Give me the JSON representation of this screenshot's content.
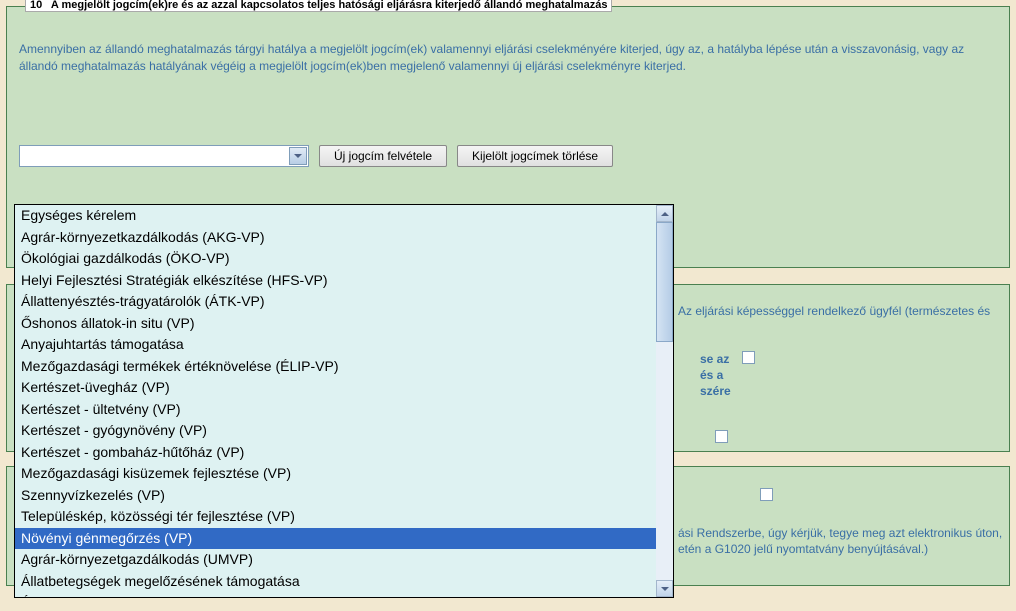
{
  "section10": {
    "number": "10",
    "title": "A megjelölt jogcím(ek)re és az azzal kapcsolatos teljes hatósági eljárásra kiterjedő állandó meghatalmazás",
    "description": "Amennyiben az állandó meghatalmazás tárgyi hatálya a megjelölt jogcím(ek) valamennyi eljárási cselekményére kiterjed, úgy az, a hatályba lépése után a visszavonásig, vagy az állandó meghatalmazás hatályának végéig a megjelölt jogcím(ek)ben megjelenő valamennyi új eljárási cselekményre kiterjed.",
    "btn_new": "Új jogcím felvétele",
    "btn_delete": "Kijelölt jogcímek törlése"
  },
  "dropdown": {
    "items": [
      "Egységes kérelem",
      "Agrár-környezetkazdálkodás (AKG-VP)",
      "Ökológiai gazdálkodás (ÖKO-VP)",
      "Helyi Fejlesztési Stratégiák elkészítése (HFS-VP)",
      "Állattenyésztés-trágyatárolók (ÁTK-VP)",
      "Őshonos állatok-in situ (VP)",
      "Anyajuhtartás támogatása",
      "Mezőgazdasági termékek értéknövelése (ÉLIP-VP)",
      "Kertészet-üvegház (VP)",
      "Kertészet - ültetvény (VP)",
      "Kertészet - gyógynövény (VP)",
      "Kertészet - gombaház-hűtőház (VP)",
      "Mezőgazdasági kisüzemek fejlesztése (VP)",
      "Szennyvízkezelés (VP)",
      "Településkép, közösségi tér fejlesztése (VP)",
      "Növényi génmegőrzés (VP)",
      "Agrár-környezetgazdálkodás (UMVP)",
      "Állatbetegségek megelőzésének támogatása",
      "Állati génmegőrzés"
    ],
    "highlighted_index": 15
  },
  "partial": {
    "line1": "Az eljárási képességgel rendelkező ügyfél (természetes és",
    "line2a": "se az",
    "line2b": "és a",
    "line2c": "szére",
    "line3": "ási Rendszerbe, úgy kérjük, tegye meg azt elektronikus úton,",
    "line4": "etén a G1020 jelű nyomtatvány benyújtásával.)"
  }
}
